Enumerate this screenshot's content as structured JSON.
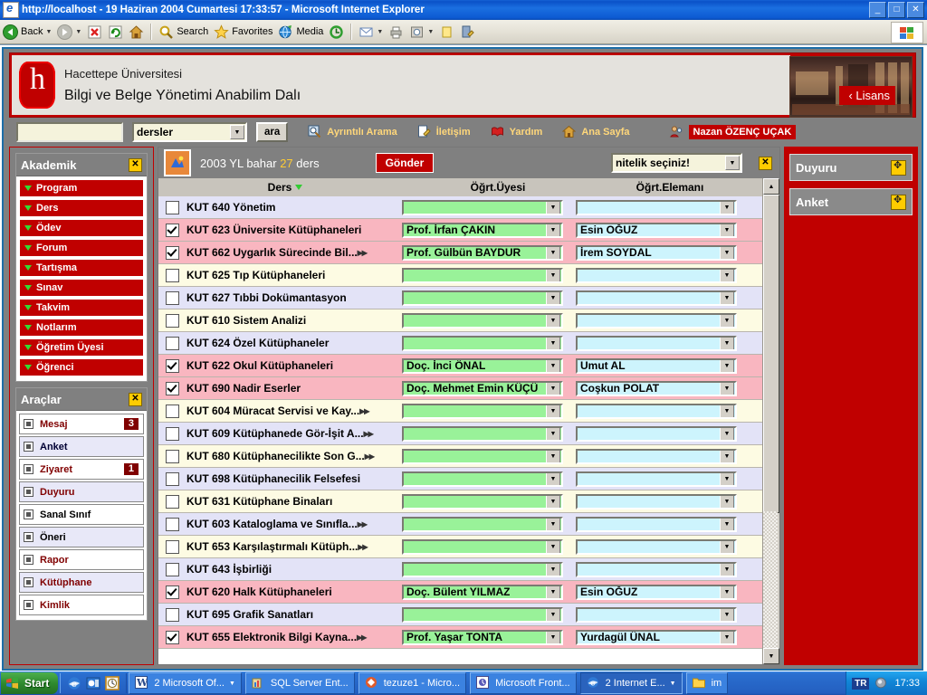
{
  "window": {
    "title": "http://localhost - 19 Haziran 2004 Cumartesi 17:33:57 - Microsoft Internet Explorer",
    "minimize": "_",
    "maximize": "□",
    "close": "✕"
  },
  "toolbar": {
    "back": "Back",
    "search": "Search",
    "favorites": "Favorites",
    "media": "Media"
  },
  "header": {
    "line1": "Hacettepe Üniversitesi",
    "line2": "Bilgi ve Belge Yönetimi Anabilim Dalı",
    "photo_tag": "‹ Lisans"
  },
  "navbar": {
    "search_value": "",
    "search_placeholder": "",
    "scope_select": "dersler",
    "search_button": "ara",
    "links": [
      {
        "label": "Ayrıntılı Arama",
        "icon": "detailed-search-icon"
      },
      {
        "label": "İletişim",
        "icon": "contact-icon"
      },
      {
        "label": "Yardım",
        "icon": "help-book-icon"
      },
      {
        "label": "Ana Sayfa",
        "icon": "home-icon"
      }
    ],
    "user": "Nazan ÖZENÇ UÇAK"
  },
  "sidebar_left": {
    "akademik": {
      "title": "Akademik",
      "close": "✕",
      "items": [
        {
          "label": "Program"
        },
        {
          "label": "Ders"
        },
        {
          "label": "Ödev"
        },
        {
          "label": "Forum"
        },
        {
          "label": "Tartışma"
        },
        {
          "label": "Sınav"
        },
        {
          "label": "Takvim"
        },
        {
          "label": "Notlarım"
        },
        {
          "label": "Öğretim Üyesi"
        },
        {
          "label": "Öğrenci"
        }
      ]
    },
    "araclar": {
      "title": "Araçlar",
      "close": "✕",
      "items": [
        {
          "label": "Mesaj",
          "badge": "3",
          "color": "#800000",
          "bg": "#ffffff"
        },
        {
          "label": "Anket",
          "badge": "",
          "color": "#000033",
          "bg": "#e8e8f8"
        },
        {
          "label": "Ziyaret",
          "badge": "1",
          "color": "#800000",
          "bg": "#ffffff"
        },
        {
          "label": "Duyuru",
          "badge": "",
          "color": "#800000",
          "bg": "#e8e8f8"
        },
        {
          "label": "Sanal Sınıf",
          "badge": "",
          "color": "#000000",
          "bg": "#ffffff"
        },
        {
          "label": "Öneri",
          "badge": "",
          "color": "#000000",
          "bg": "#e8e8f8"
        },
        {
          "label": "Rapor",
          "badge": "",
          "color": "#800000",
          "bg": "#ffffff"
        },
        {
          "label": "Kütüphane",
          "badge": "",
          "color": "#800000",
          "bg": "#e8e8f8"
        },
        {
          "label": "Kimlik",
          "badge": "",
          "color": "#800000",
          "bg": "#ffffff"
        }
      ]
    }
  },
  "sidebar_right": {
    "panels": [
      {
        "title": "Duyuru"
      },
      {
        "title": "Anket"
      }
    ]
  },
  "main": {
    "term": "2003 YL bahar",
    "count": "27",
    "count_suffix": "ders",
    "submit_button": "Gönder",
    "attribute_select": "nitelik seçiniz!",
    "close": "✕",
    "columns": [
      {
        "label": "Ders",
        "sorted": true
      },
      {
        "label": "Öğrt.Üyesi"
      },
      {
        "label": "Öğrt.Elemanı"
      }
    ],
    "rows": [
      {
        "checked": false,
        "code": "KUT 640",
        "name": "Yönetim",
        "truncated": false,
        "uye": "",
        "eleman": "",
        "zebra": 0
      },
      {
        "checked": true,
        "code": "KUT 623",
        "name": "Üniversite Kütüphaneleri",
        "truncated": false,
        "uye": "Prof. İrfan ÇAKIN",
        "eleman": "Esin OĞUZ",
        "zebra": 1
      },
      {
        "checked": true,
        "code": "KUT 662",
        "name": "Uygarlık Sürecinde Bil...",
        "truncated": true,
        "uye": "Prof. Gülbün BAYDUR",
        "eleman": "İrem SOYDAL",
        "zebra": 0
      },
      {
        "checked": false,
        "code": "KUT 625",
        "name": "Tıp Kütüphaneleri",
        "truncated": false,
        "uye": "",
        "eleman": "",
        "zebra": 1
      },
      {
        "checked": false,
        "code": "KUT 627",
        "name": "Tıbbi Dokümantasyon",
        "truncated": false,
        "uye": "",
        "eleman": "",
        "zebra": 0
      },
      {
        "checked": false,
        "code": "KUT 610",
        "name": "Sistem Analizi",
        "truncated": false,
        "uye": "",
        "eleman": "",
        "zebra": 1
      },
      {
        "checked": false,
        "code": "KUT 624",
        "name": "Özel Kütüphaneler",
        "truncated": false,
        "uye": "",
        "eleman": "",
        "zebra": 0
      },
      {
        "checked": true,
        "code": "KUT 622",
        "name": "Okul Kütüphaneleri",
        "truncated": false,
        "uye": "Doç. İnci ÖNAL",
        "eleman": "Umut AL",
        "zebra": 1
      },
      {
        "checked": true,
        "code": "KUT 690",
        "name": "Nadir Eserler",
        "truncated": false,
        "uye": "Doç. Mehmet Emin KÜÇÜ",
        "eleman": "Coşkun POLAT",
        "zebra": 0
      },
      {
        "checked": false,
        "code": "KUT 604",
        "name": "Müracat Servisi ve Kay...",
        "truncated": true,
        "uye": "",
        "eleman": "",
        "zebra": 1
      },
      {
        "checked": false,
        "code": "KUT 609",
        "name": "Kütüphanede Gör-İşit A...",
        "truncated": true,
        "uye": "",
        "eleman": "",
        "zebra": 0
      },
      {
        "checked": false,
        "code": "KUT 680",
        "name": "Kütüphanecilikte Son G...",
        "truncated": true,
        "uye": "",
        "eleman": "",
        "zebra": 1
      },
      {
        "checked": false,
        "code": "KUT 698",
        "name": "Kütüphanecilik Felsefesi",
        "truncated": false,
        "uye": "",
        "eleman": "",
        "zebra": 0
      },
      {
        "checked": false,
        "code": "KUT 631",
        "name": "Kütüphane Binaları",
        "truncated": false,
        "uye": "",
        "eleman": "",
        "zebra": 1
      },
      {
        "checked": false,
        "code": "KUT 603",
        "name": "Kataloglama ve Sınıfla...",
        "truncated": true,
        "uye": "",
        "eleman": "",
        "zebra": 0
      },
      {
        "checked": false,
        "code": "KUT 653",
        "name": "Karşılaştırmalı Kütüph...",
        "truncated": true,
        "uye": "",
        "eleman": "",
        "zebra": 1
      },
      {
        "checked": false,
        "code": "KUT 643",
        "name": "İşbirliği",
        "truncated": false,
        "uye": "",
        "eleman": "",
        "zebra": 0
      },
      {
        "checked": true,
        "code": "KUT 620",
        "name": "Halk Kütüphaneleri",
        "truncated": false,
        "uye": "Doç. Bülent YILMAZ",
        "eleman": "Esin OĞUZ",
        "zebra": 1
      },
      {
        "checked": false,
        "code": "KUT 695",
        "name": "Grafik Sanatları",
        "truncated": false,
        "uye": "",
        "eleman": "",
        "zebra": 0
      },
      {
        "checked": true,
        "code": "KUT 655",
        "name": "Elektronik Bilgi Kayna...",
        "truncated": true,
        "uye": "Prof. Yaşar TONTA",
        "eleman": "Yurdagül ÜNAL",
        "zebra": 1
      }
    ]
  },
  "taskbar": {
    "start": "Start",
    "buttons": [
      {
        "label": "2 Microsoft Of...",
        "icon": "word-icon",
        "group": true,
        "active": false
      },
      {
        "label": "SQL Server Ent...",
        "icon": "sql-icon",
        "group": false,
        "active": false
      },
      {
        "label": "tezuze1 - Micro...",
        "icon": "frontpage-icon",
        "group": false,
        "active": false
      },
      {
        "label": "Microsoft Front...",
        "icon": "frontpage2-icon",
        "group": false,
        "active": false
      },
      {
        "label": "2 Internet E...",
        "icon": "ie-icon",
        "group": true,
        "active": true
      },
      {
        "label": "im",
        "icon": "folder-icon",
        "group": false,
        "active": false
      }
    ],
    "lang": "TR",
    "clock": "17:33"
  },
  "colors": {
    "brand_red": "#c00000",
    "selected_row": "#f9b6c0",
    "zebra_a": "#e3e3f7",
    "zebra_b": "#fdfbe3",
    "uye_field": "#99f299",
    "eleman_field": "#cdf4fd",
    "accent_yellow": "#ffcc00"
  }
}
